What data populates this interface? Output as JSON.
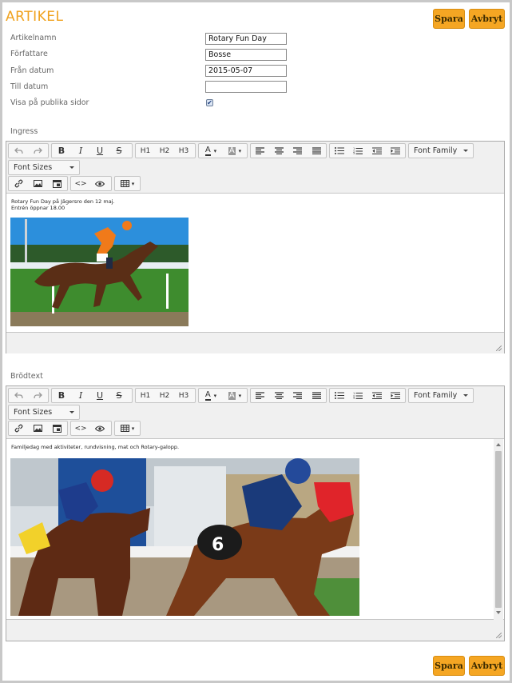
{
  "header": {
    "title": "ARTIKEL",
    "save_label": "Spara",
    "cancel_label": "Avbryt"
  },
  "form": {
    "fields": [
      {
        "label": "Artikelnamn",
        "value": "Rotary Fun Day"
      },
      {
        "label": "Författare",
        "value": "Bosse"
      },
      {
        "label": "Från datum",
        "value": "2015-05-07"
      },
      {
        "label": "Till datum",
        "value": ""
      }
    ],
    "publish_label": "Visa på publika sidor",
    "publish_checked": true
  },
  "toolbar": {
    "h1": "H1",
    "h2": "H2",
    "h3": "H3",
    "bold": "B",
    "italic": "I",
    "underline": "U",
    "strike": "S",
    "font_color": "A",
    "bg_color": "A",
    "font_family": "Font Family",
    "font_sizes": "Font Sizes",
    "code": "<>"
  },
  "ingress": {
    "label": "Ingress",
    "line1": "Rotary Fun Day på Jägersro den 12 maj.",
    "line2": "Entrén öppnar 18.00"
  },
  "brodtext": {
    "label": "Brödtext",
    "line1": "Familjedag med aktiviteter, rundvisning, mat och Rotary-galopp."
  },
  "footer": {
    "save_label": "Spara",
    "cancel_label": "Avbryt"
  },
  "colors": {
    "accent": "#f5a623",
    "title": "#f0a21e"
  }
}
